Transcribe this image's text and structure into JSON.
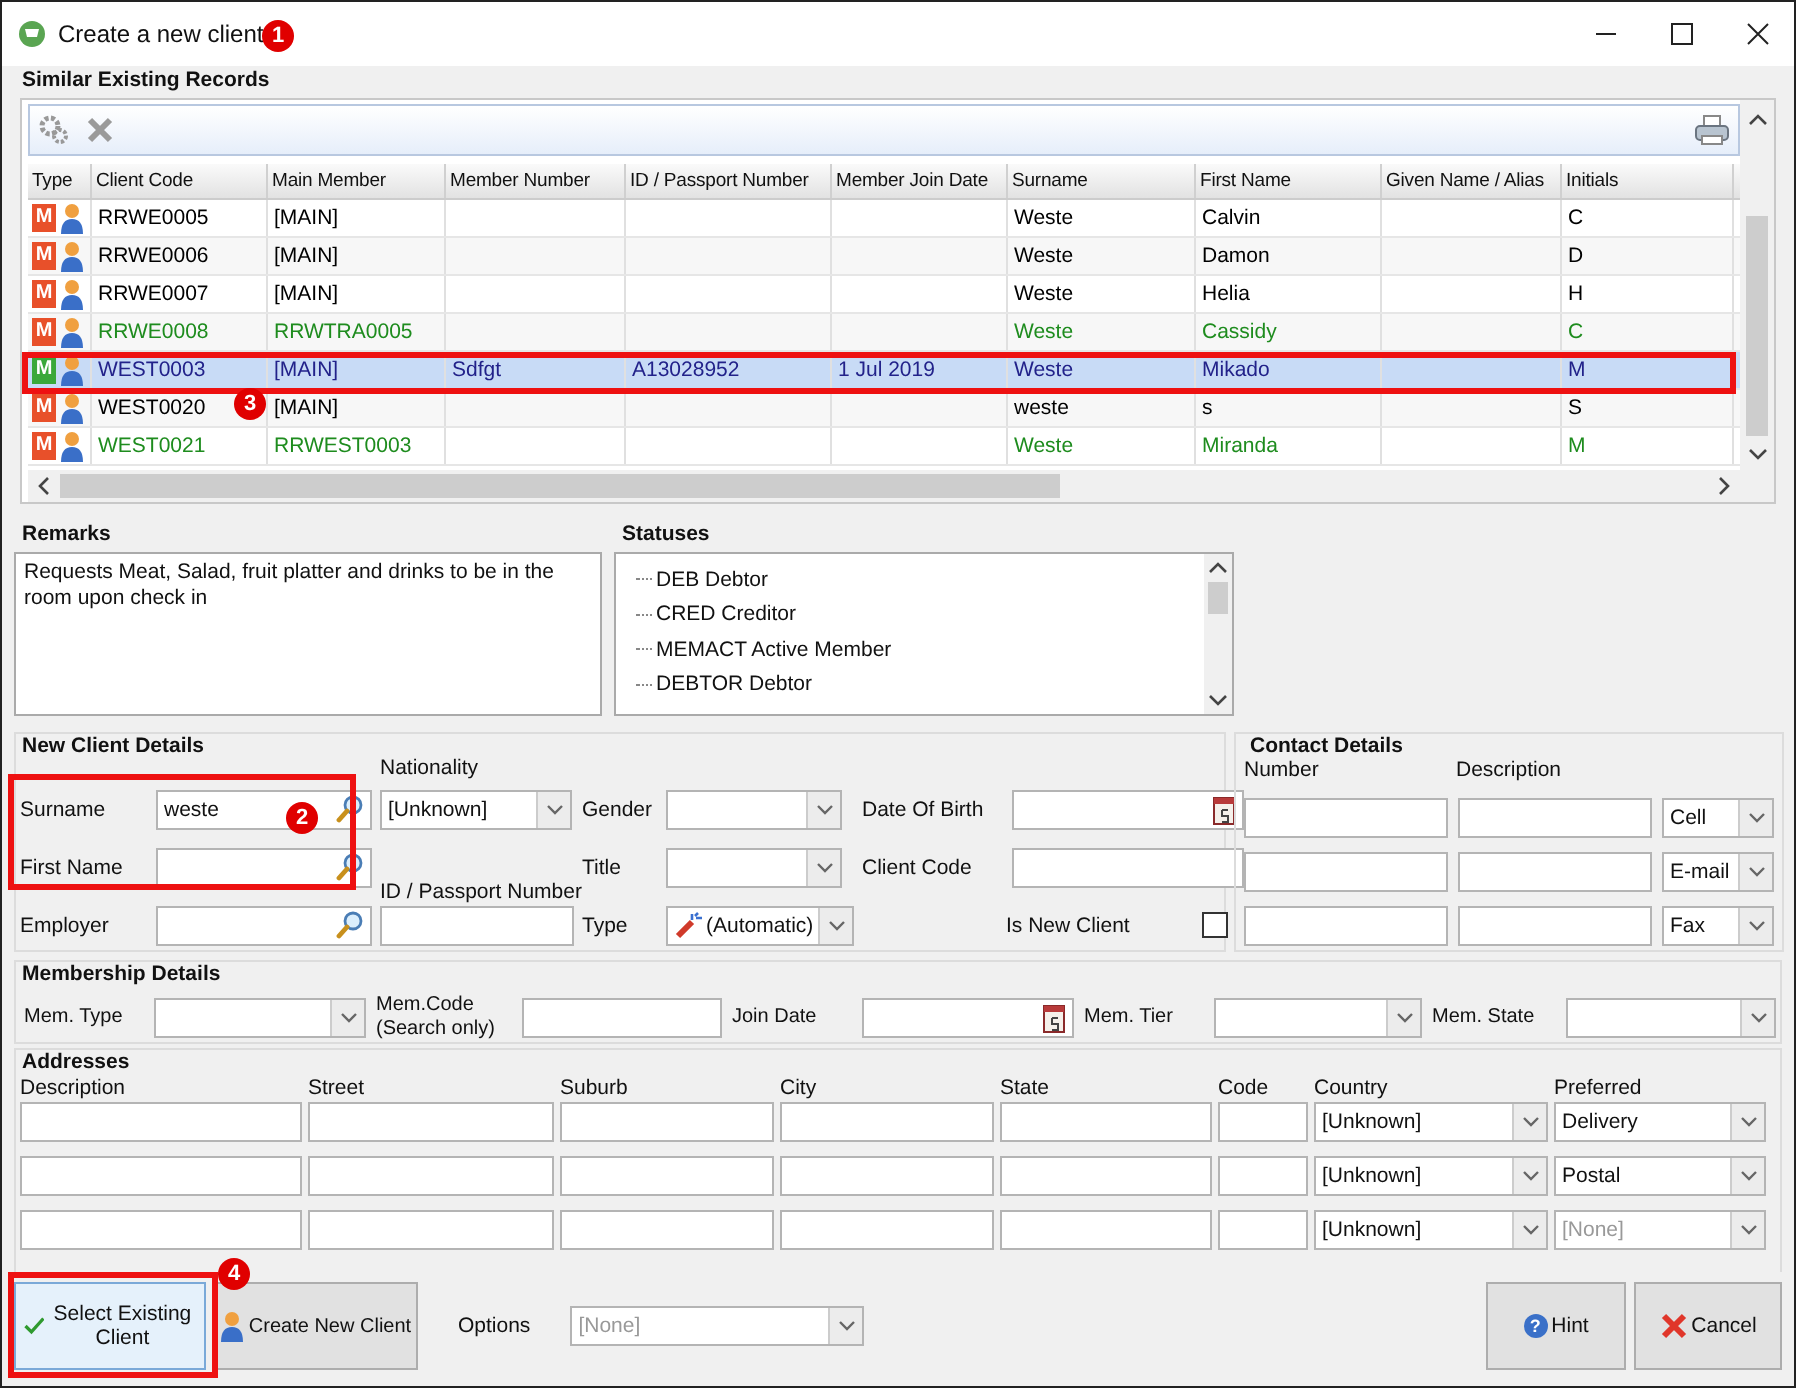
{
  "window": {
    "title": "Create a new client"
  },
  "callouts": [
    "1",
    "2",
    "3",
    "4"
  ],
  "similar_records": {
    "title": "Similar Existing Records",
    "columns": [
      "Type",
      "Client Code",
      "Main Member",
      "Member Number",
      "ID / Passport Number",
      "Member Join Date",
      "Surname",
      "First Name",
      "Given Name / Alias",
      "Initials"
    ],
    "rows": [
      {
        "selected": false,
        "color": "#000000",
        "cells": [
          "M",
          "RRWE0005",
          "[MAIN]",
          "",
          "",
          "",
          "Weste",
          "Calvin",
          "",
          "C"
        ]
      },
      {
        "selected": false,
        "color": "#000000",
        "cells": [
          "M",
          "RRWE0006",
          "[MAIN]",
          "",
          "",
          "",
          "Weste",
          "Damon",
          "",
          "D"
        ]
      },
      {
        "selected": false,
        "color": "#000000",
        "cells": [
          "M",
          "RRWE0007",
          "[MAIN]",
          "",
          "",
          "",
          "Weste",
          "Helia",
          "",
          "H"
        ]
      },
      {
        "selected": false,
        "color": "#1e8c1e",
        "cells": [
          "M",
          "RRWE0008",
          "RRWTRA0005",
          "",
          "",
          "",
          "Weste",
          "Cassidy",
          "",
          "C"
        ]
      },
      {
        "selected": true,
        "color": "#22228a",
        "cells": [
          "M",
          "WEST0003",
          "[MAIN]",
          "Sdfgt",
          "A13028952",
          "1 Jul 2019",
          "Weste",
          "Mikado",
          "",
          "M"
        ]
      },
      {
        "selected": false,
        "color": "#000000",
        "cells": [
          "M",
          "WEST0020",
          "[MAIN]",
          "",
          "",
          "",
          "weste",
          "s",
          "",
          "S"
        ]
      },
      {
        "selected": false,
        "color": "#1e8c1e",
        "cells": [
          "M",
          "WEST0021",
          "RRWEST0003",
          "",
          "",
          "",
          "Weste",
          "Miranda",
          "",
          "M"
        ]
      }
    ]
  },
  "remarks": {
    "title": "Remarks",
    "text": "Requests Meat, Salad, fruit platter and drinks to be in the room upon check in"
  },
  "statuses": {
    "title": "Statuses",
    "items": [
      "DEB Debtor",
      "CRED Creditor",
      "MEMACT Active Member",
      "DEBTOR Debtor"
    ]
  },
  "new_client": {
    "title": "New Client Details",
    "surname": {
      "label": "Surname",
      "value": "weste"
    },
    "first_name": {
      "label": "First Name"
    },
    "employer": {
      "label": "Employer"
    },
    "nationality": {
      "label": "Nationality",
      "value": "[Unknown]"
    },
    "id_passport": {
      "label": "ID / Passport Number"
    },
    "gender": {
      "label": "Gender"
    },
    "title_field": {
      "label": "Title"
    },
    "type": {
      "label": "Type",
      "value": "(Automatic)"
    },
    "date_of_birth": {
      "label": "Date Of Birth"
    },
    "client_code": {
      "label": "Client Code"
    },
    "is_new_client": {
      "label": "Is New Client",
      "checked": false
    }
  },
  "contact_details": {
    "title": "Contact Details",
    "columns": [
      "Number",
      "Description"
    ],
    "rows": [
      {
        "type": "Cell"
      },
      {
        "type": "E-mail"
      },
      {
        "type": "Fax"
      }
    ]
  },
  "membership": {
    "title": "Membership Details",
    "fields": [
      {
        "label": "Mem. Type",
        "kind": "combo"
      },
      {
        "label": "Mem.Code (Search only)",
        "kind": "text"
      },
      {
        "label": "Join Date",
        "kind": "date"
      },
      {
        "label": "Mem. Tier",
        "kind": "combo"
      },
      {
        "label": "Mem. State",
        "kind": "combo"
      }
    ]
  },
  "addresses": {
    "title": "Addresses",
    "columns": [
      "Description",
      "Street",
      "Suburb",
      "City",
      "State",
      "Code",
      "Country",
      "Preferred"
    ],
    "rows": [
      {
        "country": "[Unknown]",
        "preferred": "Delivery"
      },
      {
        "country": "[Unknown]",
        "preferred": "Postal"
      },
      {
        "country": "[Unknown]",
        "preferred_placeholder": "[None]"
      }
    ]
  },
  "footer": {
    "buttons": [
      {
        "label": "Select Existing Client",
        "kind": "select"
      },
      {
        "label": "Create New Client",
        "kind": "create"
      }
    ],
    "options": {
      "label": "Options",
      "placeholder": "[None]"
    },
    "right_buttons": [
      {
        "label": "Hint",
        "kind": "hint",
        "icon": "?"
      },
      {
        "label": "Cancel",
        "kind": "cancel"
      }
    ]
  }
}
